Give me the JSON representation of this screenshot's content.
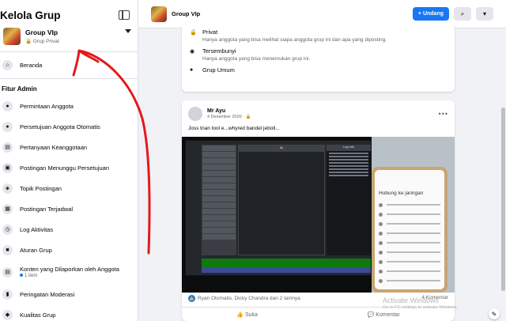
{
  "sidebar": {
    "title": "Kelola Grup",
    "group": {
      "name": "Group VIp",
      "privacy": "Grup Privat"
    },
    "home": "Beranda",
    "section_label": "Fitur Admin",
    "items": [
      {
        "label": "Permintaan Anggota",
        "icon": "people-icon"
      },
      {
        "label": "Persetujuan Anggota Otomatis",
        "icon": "people-auto-icon"
      },
      {
        "label": "Pertanyaan Keanggotaan",
        "icon": "question-icon"
      },
      {
        "label": "Postingan Menunggu Persetujuan",
        "icon": "post-pending-icon"
      },
      {
        "label": "Topik Postingan",
        "icon": "tag-icon"
      },
      {
        "label": "Postingan Terjadwal",
        "icon": "calendar-icon"
      },
      {
        "label": "Log Aktivitas",
        "icon": "clock-icon"
      },
      {
        "label": "Aturan Grup",
        "icon": "rules-icon"
      },
      {
        "label": "Konten yang Dilaporkan oleh Anggota",
        "sub": "1 item",
        "icon": "report-icon"
      },
      {
        "label": "Peringatan Moderasi",
        "icon": "alert-icon"
      },
      {
        "label": "Kualitas Grup",
        "icon": "quality-icon"
      }
    ]
  },
  "topbar": {
    "group_name": "Group VIp",
    "invite_label": "+ Undang",
    "search_icon": "search-icon",
    "more_icon": "more-icon"
  },
  "info": {
    "privacy_title": "Privat",
    "privacy_desc": "Hanya anggota yang bisa melihat siapa anggota grup ini dan apa yang diposting.",
    "hidden_title": "Tersembunyi",
    "hidden_desc": "Hanya anggota yang bisa menemukan grup ini.",
    "general_title": "Grup Umum"
  },
  "post": {
    "author": "Mr Ayu",
    "date": "4 Desember 2020 · ",
    "text": "Joss tnan tool e...whyred bandel jeboll...",
    "reactions": "Ryan Otomatis, Dicky Chandra dan 2 lainnya",
    "comments": "4 Komentar",
    "like_label": "Suka",
    "comment_label": "Komentar",
    "image": {
      "log_title": "Log Info",
      "main_title": "fip",
      "phone_title": "Hubung ke jaringan"
    }
  },
  "watermark": {
    "title": "Activate Windows",
    "subtitle": "Go to PC settings to activate Windows."
  },
  "colors": {
    "accent": "#1877f2",
    "annotation": "#e3191c"
  }
}
